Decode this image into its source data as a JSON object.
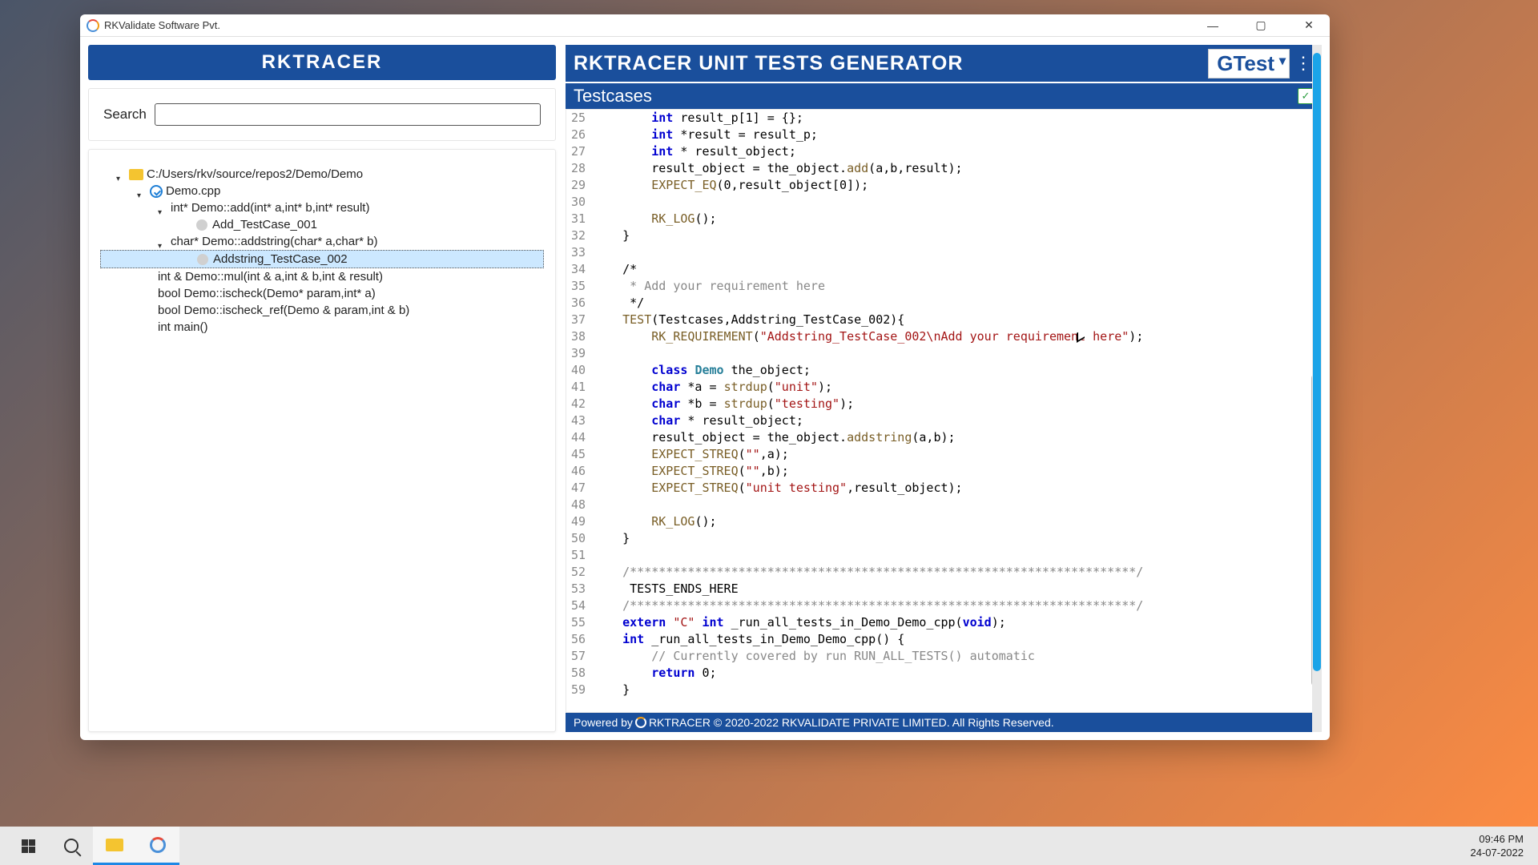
{
  "window": {
    "title": "RKValidate Software Pvt."
  },
  "left": {
    "header": "RKTRACER",
    "search_label": "Search"
  },
  "tree": {
    "root": "C:/Users/rkv/source/repos2/Demo/Demo",
    "file": "Demo.cpp",
    "fn1": "int* Demo::add(int* a,int* b,int* result)",
    "tc1": "Add_TestCase_001",
    "fn2": "char* Demo::addstring(char* a,char* b)",
    "tc2": "Addstring_TestCase_002",
    "fn3": "int & Demo::mul(int & a,int & b,int & result)",
    "fn4": "bool Demo::ischeck(Demo* param,int* a)",
    "fn5": "bool Demo::ischeck_ref(Demo & param,int & b)",
    "fn6": "int main()"
  },
  "right": {
    "title": "RKTRACER UNIT TESTS GENERATOR",
    "framework": "GTest",
    "subheader": "Testcases"
  },
  "code": [
    {
      "n": 25,
      "segs": [
        {
          "t": "        "
        },
        {
          "t": "int",
          "c": "kw"
        },
        {
          "t": " result_p[1] = {};"
        }
      ]
    },
    {
      "n": 26,
      "segs": [
        {
          "t": "        "
        },
        {
          "t": "int",
          "c": "kw"
        },
        {
          "t": " *result = result_p;"
        }
      ]
    },
    {
      "n": 27,
      "segs": [
        {
          "t": "        "
        },
        {
          "t": "int",
          "c": "kw"
        },
        {
          "t": " * result_object;"
        }
      ]
    },
    {
      "n": 28,
      "segs": [
        {
          "t": "        result_object = the_object."
        },
        {
          "t": "add",
          "c": "fn"
        },
        {
          "t": "(a,b,result);"
        }
      ]
    },
    {
      "n": 29,
      "segs": [
        {
          "t": "        "
        },
        {
          "t": "EXPECT_EQ",
          "c": "fn"
        },
        {
          "t": "(0,result_object[0]);"
        }
      ]
    },
    {
      "n": 30,
      "segs": [
        {
          "t": ""
        }
      ]
    },
    {
      "n": 31,
      "segs": [
        {
          "t": "        "
        },
        {
          "t": "RK_LOG",
          "c": "fn"
        },
        {
          "t": "();"
        }
      ]
    },
    {
      "n": 32,
      "segs": [
        {
          "t": "    }"
        }
      ]
    },
    {
      "n": 33,
      "segs": [
        {
          "t": ""
        }
      ]
    },
    {
      "n": 34,
      "segs": [
        {
          "t": "    /*"
        }
      ]
    },
    {
      "n": 35,
      "segs": [
        {
          "t": "     * Add your requirement here",
          "c": "cm"
        }
      ]
    },
    {
      "n": 36,
      "segs": [
        {
          "t": "     */"
        }
      ]
    },
    {
      "n": 37,
      "segs": [
        {
          "t": "    "
        },
        {
          "t": "TEST",
          "c": "fn"
        },
        {
          "t": "(Testcases,Addstring_TestCase_002){"
        }
      ]
    },
    {
      "n": 38,
      "segs": [
        {
          "t": "        "
        },
        {
          "t": "RK_REQUIREMENT",
          "c": "fn"
        },
        {
          "t": "("
        },
        {
          "t": "\"Addstring_TestCase_002\\nAdd your requirement here\"",
          "c": "str"
        },
        {
          "t": ");"
        }
      ]
    },
    {
      "n": 39,
      "segs": [
        {
          "t": ""
        }
      ]
    },
    {
      "n": 40,
      "segs": [
        {
          "t": "        "
        },
        {
          "t": "class",
          "c": "kw"
        },
        {
          "t": " "
        },
        {
          "t": "Demo",
          "c": "cls"
        },
        {
          "t": " the_object;"
        }
      ]
    },
    {
      "n": 41,
      "segs": [
        {
          "t": "        "
        },
        {
          "t": "char",
          "c": "kw"
        },
        {
          "t": " *a = "
        },
        {
          "t": "strdup",
          "c": "fn"
        },
        {
          "t": "("
        },
        {
          "t": "\"unit\"",
          "c": "str"
        },
        {
          "t": ");"
        }
      ]
    },
    {
      "n": 42,
      "segs": [
        {
          "t": "        "
        },
        {
          "t": "char",
          "c": "kw"
        },
        {
          "t": " *b = "
        },
        {
          "t": "strdup",
          "c": "fn"
        },
        {
          "t": "("
        },
        {
          "t": "\"testing\"",
          "c": "str"
        },
        {
          "t": ");"
        }
      ]
    },
    {
      "n": 43,
      "segs": [
        {
          "t": "        "
        },
        {
          "t": "char",
          "c": "kw"
        },
        {
          "t": " * result_object;"
        }
      ]
    },
    {
      "n": 44,
      "segs": [
        {
          "t": "        result_object = the_object."
        },
        {
          "t": "addstring",
          "c": "fn"
        },
        {
          "t": "(a,b);"
        }
      ]
    },
    {
      "n": 45,
      "segs": [
        {
          "t": "        "
        },
        {
          "t": "EXPECT_STREQ",
          "c": "fn"
        },
        {
          "t": "("
        },
        {
          "t": "\"\"",
          "c": "str"
        },
        {
          "t": ",a);"
        }
      ]
    },
    {
      "n": 46,
      "segs": [
        {
          "t": "        "
        },
        {
          "t": "EXPECT_STREQ",
          "c": "fn"
        },
        {
          "t": "("
        },
        {
          "t": "\"\"",
          "c": "str"
        },
        {
          "t": ",b);"
        }
      ]
    },
    {
      "n": 47,
      "segs": [
        {
          "t": "        "
        },
        {
          "t": "EXPECT_STREQ",
          "c": "fn"
        },
        {
          "t": "("
        },
        {
          "t": "\"unit testing\"",
          "c": "str"
        },
        {
          "t": ",result_object);"
        }
      ]
    },
    {
      "n": 48,
      "segs": [
        {
          "t": ""
        }
      ]
    },
    {
      "n": 49,
      "segs": [
        {
          "t": "        "
        },
        {
          "t": "RK_LOG",
          "c": "fn"
        },
        {
          "t": "();"
        }
      ]
    },
    {
      "n": 50,
      "segs": [
        {
          "t": "    }"
        }
      ]
    },
    {
      "n": 51,
      "segs": [
        {
          "t": ""
        }
      ]
    },
    {
      "n": 52,
      "segs": [
        {
          "t": "    /**********************************************************************/",
          "c": "cm"
        }
      ]
    },
    {
      "n": 53,
      "segs": [
        {
          "t": "     TESTS_ENDS_HERE"
        }
      ]
    },
    {
      "n": 54,
      "segs": [
        {
          "t": "    /**********************************************************************/",
          "c": "cm"
        }
      ]
    },
    {
      "n": 55,
      "segs": [
        {
          "t": "    "
        },
        {
          "t": "extern",
          "c": "kw"
        },
        {
          "t": " "
        },
        {
          "t": "\"C\"",
          "c": "str"
        },
        {
          "t": " "
        },
        {
          "t": "int",
          "c": "kw"
        },
        {
          "t": " _run_all_tests_in_Demo_Demo_cpp("
        },
        {
          "t": "void",
          "c": "kw"
        },
        {
          "t": ");"
        }
      ]
    },
    {
      "n": 56,
      "segs": [
        {
          "t": "    "
        },
        {
          "t": "int",
          "c": "kw"
        },
        {
          "t": " _run_all_tests_in_Demo_Demo_cpp() {"
        }
      ]
    },
    {
      "n": 57,
      "segs": [
        {
          "t": "        // Currently covered by run RUN_ALL_TESTS() automatic",
          "c": "cm"
        }
      ]
    },
    {
      "n": 58,
      "segs": [
        {
          "t": "        "
        },
        {
          "t": "return",
          "c": "kw"
        },
        {
          "t": " 0;"
        }
      ]
    },
    {
      "n": 59,
      "segs": [
        {
          "t": "    }"
        }
      ]
    }
  ],
  "footer": {
    "prefix": "Powered by",
    "brand": "RKTRACER",
    "rest": "© 2020-2022 RKVALIDATE PRIVATE LIMITED. All Rights Reserved."
  },
  "taskbar": {
    "time": "09:46 PM",
    "date": "24-07-2022"
  }
}
